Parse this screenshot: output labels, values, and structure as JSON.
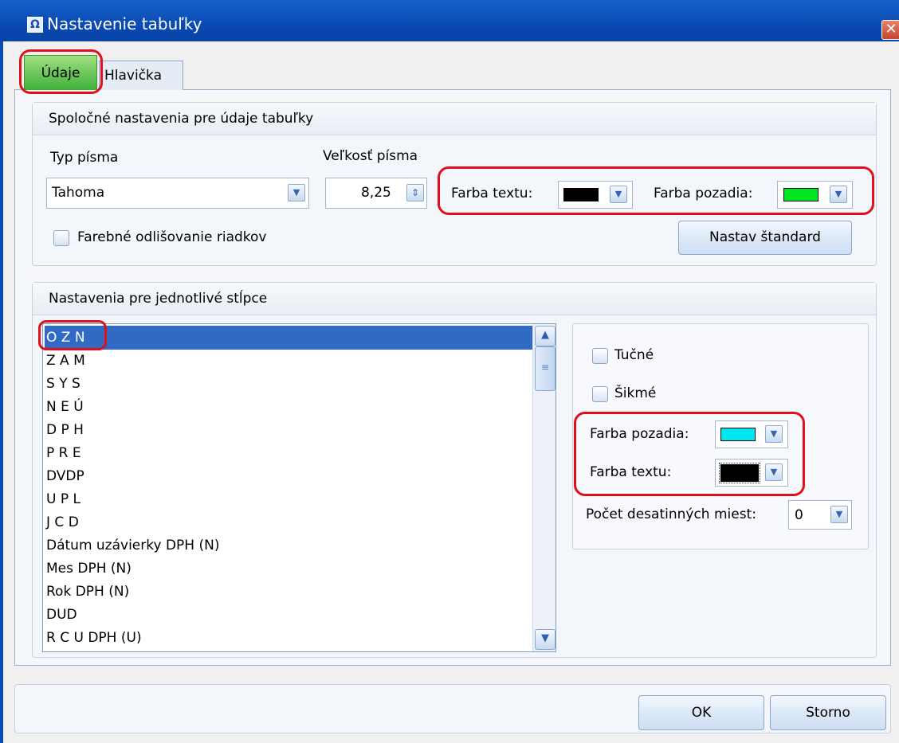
{
  "window": {
    "title": "Nastavenie tabuľky",
    "app_icon_glyph": "Ω",
    "close_glyph": "✕"
  },
  "tabs": [
    {
      "label": "Údaje",
      "active": true
    },
    {
      "label": "Hlavička",
      "active": false
    }
  ],
  "common": {
    "header": "Spoločné nastavenia pre údaje tabuľky",
    "font_type_label": "Typ písma",
    "font_type_value": "Tahoma",
    "font_size_label": "Veľkosť písma",
    "font_size_value": "8,25",
    "text_color_label": "Farba textu:",
    "text_color": "#000000",
    "bg_color_label": "Farba pozadia:",
    "bg_color": "#00e61e",
    "alt_rows_label": "Farebné odlišovanie riadkov",
    "alt_rows_checked": false,
    "reset_button": "Nastav štandard"
  },
  "columns": {
    "header": "Nastavenia pre jednotlivé stĺpce",
    "items": [
      "O Z N",
      "Z A M",
      "S Y S",
      "N E Ú",
      "D P H",
      "P R E",
      "DVDP",
      "U P L",
      "J C D",
      "Dátum uzávierky DPH (N)",
      "Mes DPH (N)",
      "Rok DPH (N)",
      "DUD",
      "R C U DPH (U)"
    ],
    "selected_index": 0,
    "bold_label": "Tučné",
    "italic_label": "Šikmé",
    "bg_color_label": "Farba pozadia:",
    "bg_color": "#00e8ef",
    "text_color_label": "Farba textu:",
    "text_color": "#000000",
    "decimals_label": "Počet desatinných miest:",
    "decimals_value": "0"
  },
  "buttons": {
    "ok": "OK",
    "cancel": "Storno"
  },
  "icons": {
    "dropdown": "chevron-down-icon",
    "spin": "spinner-icon",
    "scroll_up": "arrow-up-icon",
    "scroll_down": "arrow-down-icon"
  }
}
